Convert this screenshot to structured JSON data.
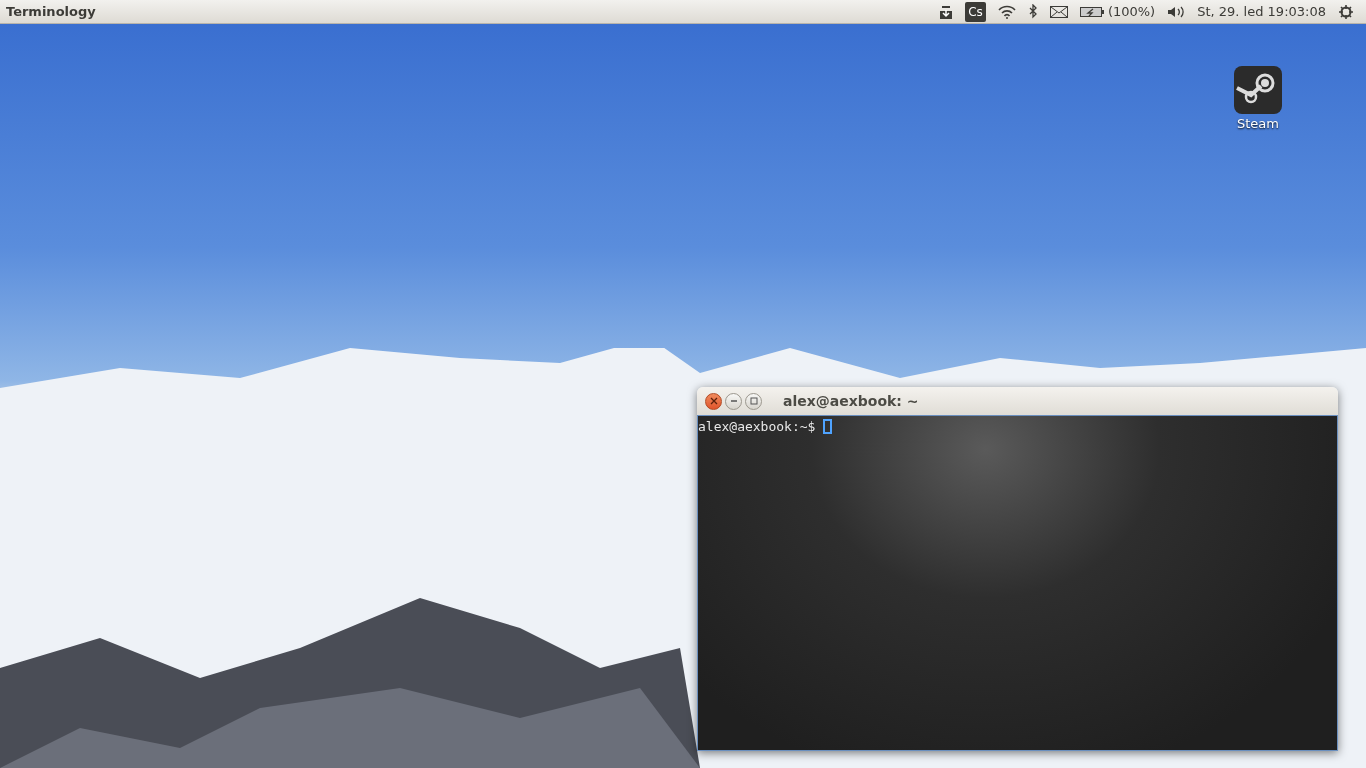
{
  "top_panel": {
    "app_title": "Terminology",
    "indicators": [
      {
        "kind": "tray"
      },
      {
        "kind": "badge",
        "text": "Cs"
      },
      {
        "kind": "wifi"
      },
      {
        "kind": "bluetooth"
      },
      {
        "kind": "mail"
      },
      {
        "kind": "battery",
        "text": "(100%)"
      },
      {
        "kind": "volume"
      },
      {
        "kind": "clock",
        "text": "St, 29. led 19:03:08"
      },
      {
        "kind": "power"
      }
    ]
  },
  "desktop_icons": [
    {
      "label": "Steam"
    }
  ],
  "terminal_window": {
    "title": "alex@aexbook: ~",
    "lines": [
      "alex@aexbook:~$"
    ],
    "cursor_visible": true
  }
}
